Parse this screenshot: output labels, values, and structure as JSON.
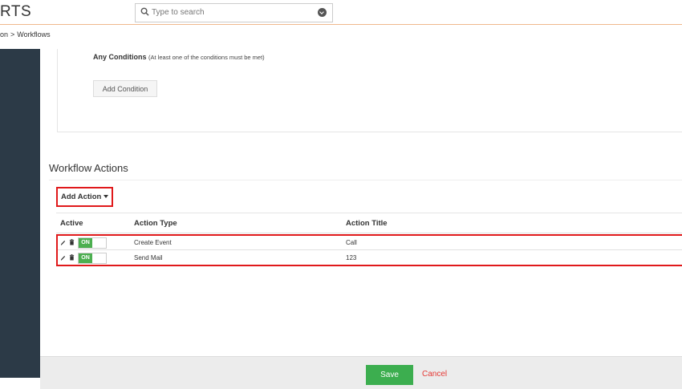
{
  "header": {
    "logo_text": "RTS",
    "search": {
      "placeholder": "Type to search"
    }
  },
  "breadcrumb": {
    "parent": "on",
    "separator": ">",
    "current": "Workflows"
  },
  "conditions": {
    "any_title": "Any Conditions",
    "any_note": "(At least one of the conditions must be met)",
    "add_button": "Add Condition"
  },
  "workflow_actions": {
    "title": "Workflow Actions",
    "add_button": "Add Action",
    "columns": [
      "Active",
      "Action Type",
      "Action Title"
    ],
    "rows": [
      {
        "active": "ON",
        "type": "Create Event",
        "title": "Call"
      },
      {
        "active": "ON",
        "type": "Send Mail",
        "title": "123"
      }
    ]
  },
  "footer": {
    "save_label": "Save",
    "cancel_label": "Cancel"
  },
  "colors": {
    "accent_green": "#3cae4f",
    "toggle_green": "#4caf50",
    "highlight_red": "#e0191b",
    "sidebar": "#2c3a47",
    "cancel_red": "#e53935"
  }
}
